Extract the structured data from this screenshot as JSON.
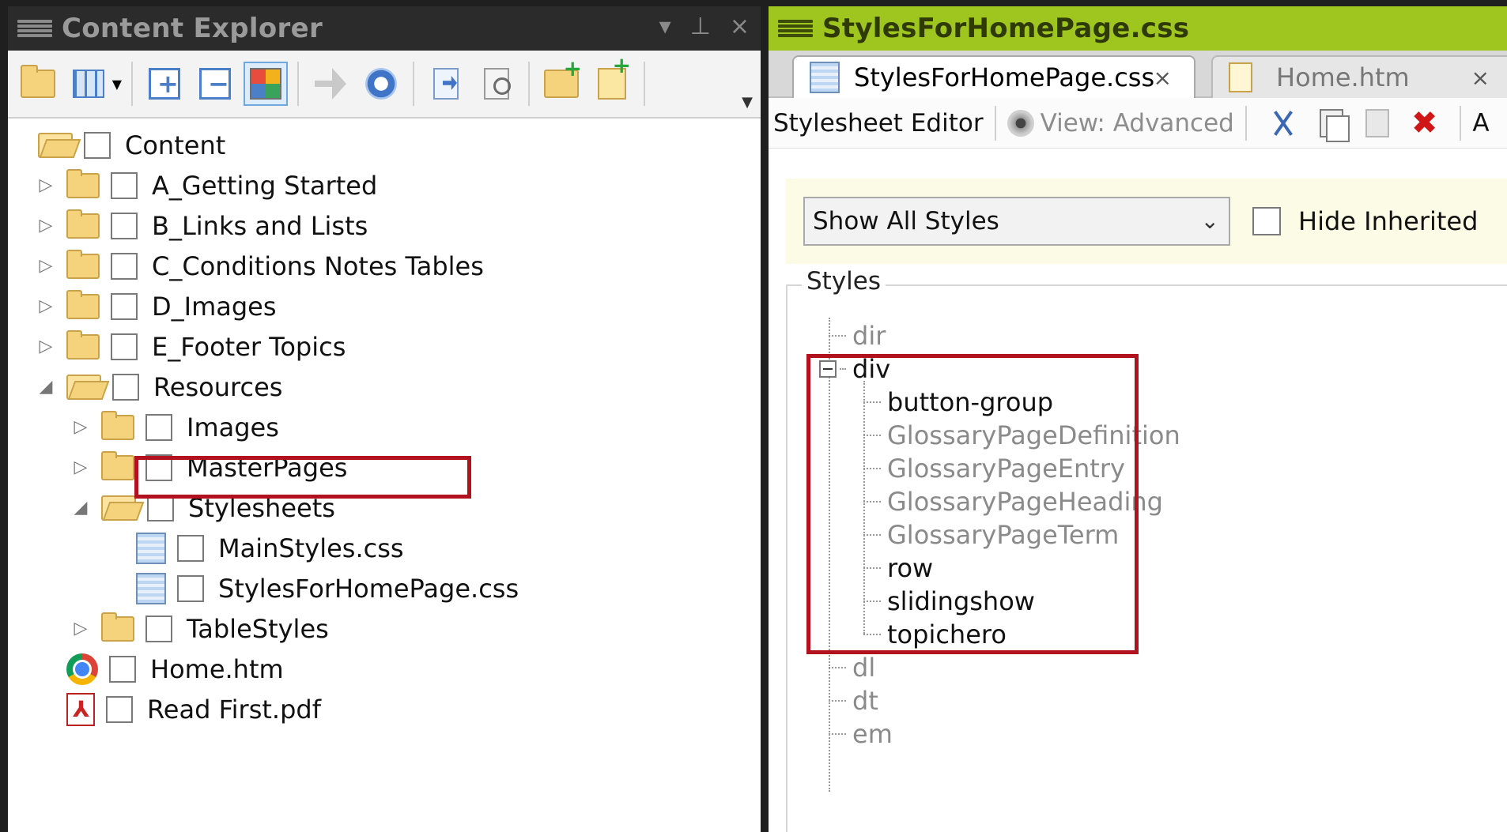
{
  "left_panel": {
    "title": "Content Explorer",
    "pin_symbol": "⊥",
    "close_symbol": "×",
    "tree": [
      {
        "label": "Content",
        "icon": "folder-open-icon",
        "expander": ""
      },
      {
        "label": "A_Getting Started",
        "icon": "folder-icon",
        "expander": "▷"
      },
      {
        "label": "B_Links and Lists",
        "icon": "folder-icon",
        "expander": "▷"
      },
      {
        "label": "C_Conditions Notes Tables",
        "icon": "folder-icon",
        "expander": "▷"
      },
      {
        "label": "D_Images",
        "icon": "folder-icon",
        "expander": "▷"
      },
      {
        "label": "E_Footer Topics",
        "icon": "folder-icon",
        "expander": "▷"
      },
      {
        "label": "Resources",
        "icon": "folder-open-icon",
        "expander": "◢"
      },
      {
        "label": "Images",
        "icon": "folder-icon",
        "expander": "▷"
      },
      {
        "label": "MasterPages",
        "icon": "folder-icon",
        "expander": "▷"
      },
      {
        "label": "Stylesheets",
        "icon": "folder-open-icon",
        "expander": "◢"
      },
      {
        "label": "MainStyles.css",
        "icon": "css-file-icon",
        "expander": ""
      },
      {
        "label": "StylesForHomePage.css",
        "icon": "css-file-icon",
        "expander": ""
      },
      {
        "label": "TableStyles",
        "icon": "folder-icon",
        "expander": "▷"
      },
      {
        "label": "Home.htm",
        "icon": "chrome-icon",
        "expander": ""
      },
      {
        "label": "Read First.pdf",
        "icon": "pdf-icon",
        "expander": ""
      }
    ]
  },
  "right_panel": {
    "title": "StylesForHomePage.css",
    "tabs": [
      {
        "label": "StylesForHomePage.css",
        "close": "×",
        "active": true
      },
      {
        "label": "Home.htm",
        "close": "×",
        "active": false
      }
    ],
    "editor_toolbar": {
      "label": "Stylesheet Editor",
      "view_label": "View: Advanced",
      "truncated_text": "A"
    },
    "filter": {
      "selected": "Show All Styles",
      "chevron": "⌄",
      "hide_inherited_label": "Hide Inherited"
    },
    "styles_legend": "Styles",
    "styles": [
      {
        "label": "dir",
        "level": 0,
        "emphasis": "dim"
      },
      {
        "label": "div",
        "level": 0,
        "emphasis": "bold",
        "expanded": true
      },
      {
        "label": "button-group",
        "level": 1,
        "emphasis": "bold"
      },
      {
        "label": "GlossaryPageDefinition",
        "level": 1,
        "emphasis": "dim"
      },
      {
        "label": "GlossaryPageEntry",
        "level": 1,
        "emphasis": "dim"
      },
      {
        "label": "GlossaryPageHeading",
        "level": 1,
        "emphasis": "dim"
      },
      {
        "label": "GlossaryPageTerm",
        "level": 1,
        "emphasis": "dim"
      },
      {
        "label": "row",
        "level": 1,
        "emphasis": "bold"
      },
      {
        "label": "slidingshow",
        "level": 1,
        "emphasis": "bold"
      },
      {
        "label": "topichero",
        "level": 1,
        "emphasis": "bold"
      },
      {
        "label": "dl",
        "level": 0,
        "emphasis": "dim"
      },
      {
        "label": "dt",
        "level": 0,
        "emphasis": "dim"
      },
      {
        "label": "em",
        "level": 0,
        "emphasis": "dim"
      }
    ]
  },
  "colors": {
    "highlight_box": "#b2121e",
    "right_header": "#9fc61f",
    "left_header": "#2b2b2b"
  }
}
